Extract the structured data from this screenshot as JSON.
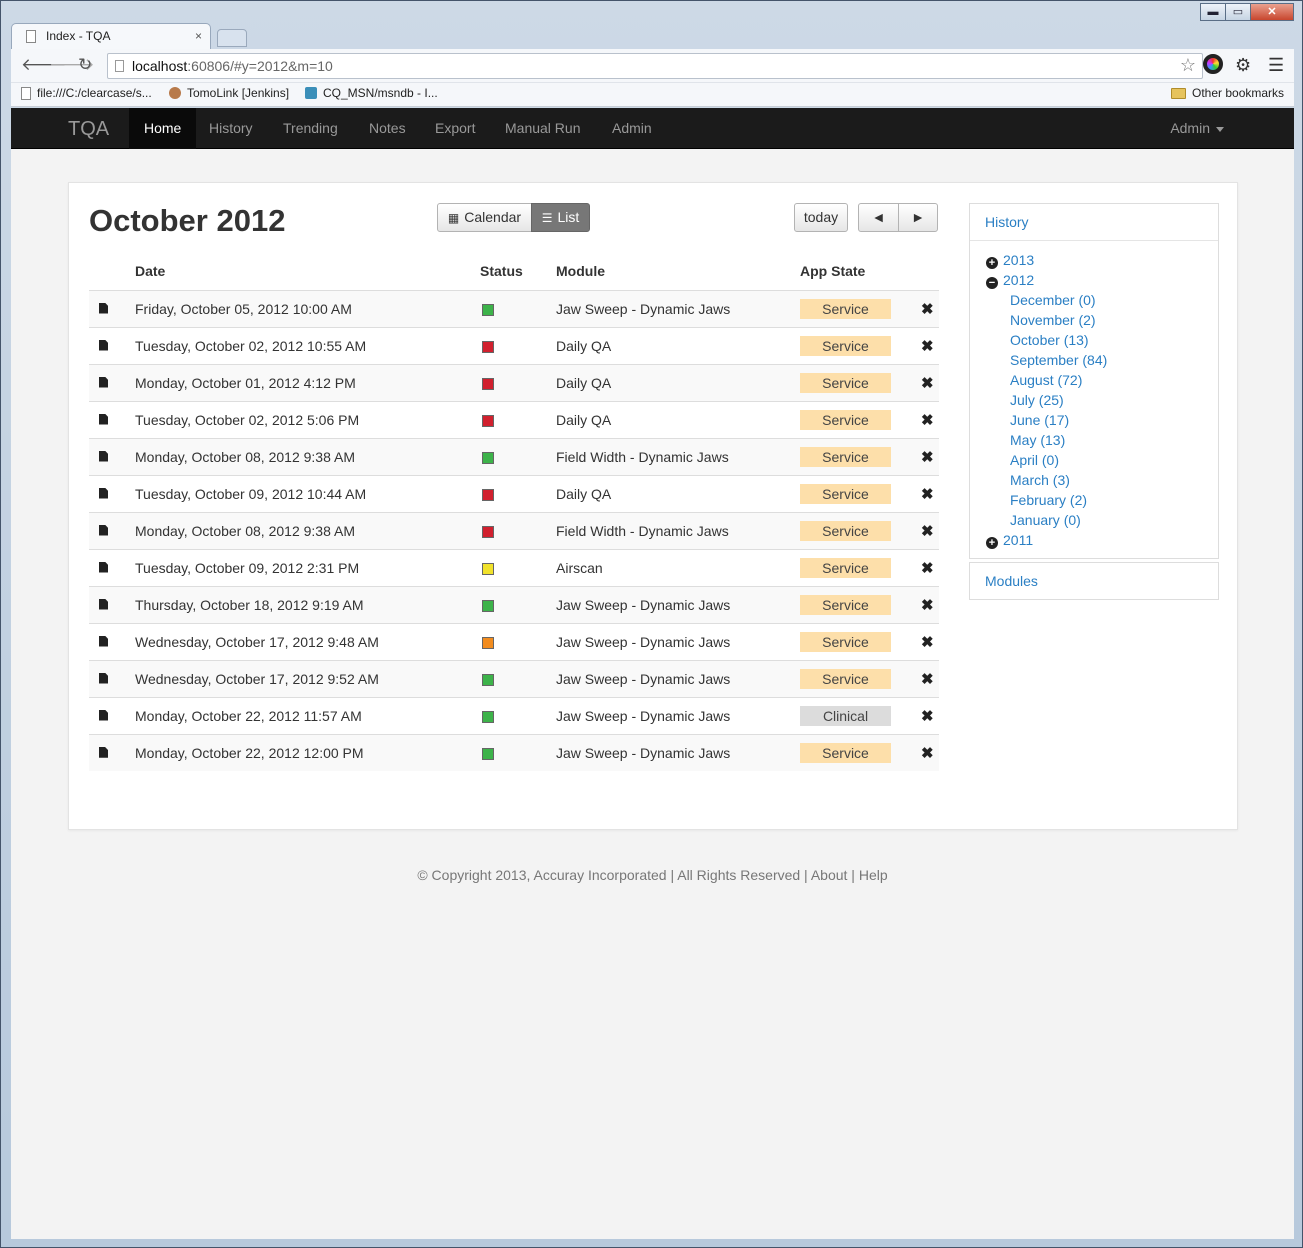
{
  "window": {
    "minimize": "▬",
    "restore": "▭",
    "close": "✕"
  },
  "tab": {
    "title": "Index - TQA",
    "close": "×"
  },
  "address": {
    "host": "localhost",
    "rest": ":60806/#y=2012&m=10"
  },
  "bookmarks": {
    "items": [
      "file:///C:/clearcase/s...",
      "TomoLink [Jenkins]",
      "CQ_MSN/msndb - I..."
    ],
    "other": "Other bookmarks"
  },
  "nav": {
    "brand": "TQA",
    "items": [
      "Home",
      "History",
      "Trending",
      "Notes",
      "Export",
      "Manual Run",
      "Admin"
    ],
    "user": "Admin"
  },
  "calendar": {
    "title": "October 2012",
    "view_calendar": "Calendar",
    "view_list": "List",
    "today": "today",
    "prev": "◄",
    "next": "►"
  },
  "table": {
    "headers": [
      "Date",
      "Status",
      "Module",
      "App State"
    ],
    "rows": [
      {
        "date": "Friday, October 05, 2012 10:00 AM",
        "status": "#3db34a",
        "module": "Jaw Sweep - Dynamic Jaws",
        "state": "Service"
      },
      {
        "date": "Tuesday, October 02, 2012 10:55 AM",
        "status": "#d1202e",
        "module": "Daily QA",
        "state": "Service"
      },
      {
        "date": "Monday, October 01, 2012 4:12 PM",
        "status": "#d1202e",
        "module": "Daily QA",
        "state": "Service"
      },
      {
        "date": "Tuesday, October 02, 2012 5:06 PM",
        "status": "#d1202e",
        "module": "Daily QA",
        "state": "Service"
      },
      {
        "date": "Monday, October 08, 2012 9:38 AM",
        "status": "#3db34a",
        "module": "Field Width - Dynamic Jaws",
        "state": "Service"
      },
      {
        "date": "Tuesday, October 09, 2012 10:44 AM",
        "status": "#d1202e",
        "module": "Daily QA",
        "state": "Service"
      },
      {
        "date": "Monday, October 08, 2012 9:38 AM",
        "status": "#d1202e",
        "module": "Field Width - Dynamic Jaws",
        "state": "Service"
      },
      {
        "date": "Tuesday, October 09, 2012 2:31 PM",
        "status": "#f1e22b",
        "module": "Airscan",
        "state": "Service"
      },
      {
        "date": "Thursday, October 18, 2012 9:19 AM",
        "status": "#3db34a",
        "module": "Jaw Sweep - Dynamic Jaws",
        "state": "Service"
      },
      {
        "date": "Wednesday, October 17, 2012 9:48 AM",
        "status": "#f28c1e",
        "module": "Jaw Sweep - Dynamic Jaws",
        "state": "Service"
      },
      {
        "date": "Wednesday, October 17, 2012 9:52 AM",
        "status": "#3db34a",
        "module": "Jaw Sweep - Dynamic Jaws",
        "state": "Service"
      },
      {
        "date": "Monday, October 22, 2012 11:57 AM",
        "status": "#3db34a",
        "module": "Jaw Sweep - Dynamic Jaws",
        "state": "Clinical"
      },
      {
        "date": "Monday, October 22, 2012 12:00 PM",
        "status": "#3db34a",
        "module": "Jaw Sweep - Dynamic Jaws",
        "state": "Service"
      }
    ]
  },
  "sidebar": {
    "history_title": "History",
    "tree": [
      {
        "label": "2013",
        "type": "year",
        "toggle": "+"
      },
      {
        "label": "2012",
        "type": "year",
        "toggle": "−"
      },
      {
        "label": "December (0)",
        "type": "month"
      },
      {
        "label": "November (2)",
        "type": "month"
      },
      {
        "label": "October (13)",
        "type": "month"
      },
      {
        "label": "September (84)",
        "type": "month"
      },
      {
        "label": "August (72)",
        "type": "month"
      },
      {
        "label": "July (25)",
        "type": "month"
      },
      {
        "label": "June (17)",
        "type": "month"
      },
      {
        "label": "May (13)",
        "type": "month"
      },
      {
        "label": "April (0)",
        "type": "month"
      },
      {
        "label": "March (3)",
        "type": "month"
      },
      {
        "label": "February (2)",
        "type": "month"
      },
      {
        "label": "January (0)",
        "type": "month"
      },
      {
        "label": "2011",
        "type": "year",
        "toggle": "+"
      }
    ],
    "modules_title": "Modules"
  },
  "footer": {
    "copyright": "© Copyright 2013, Accuray Incorporated",
    "sep1": " | ",
    "rights": "All Rights Reserved",
    "sep2": " | ",
    "about": "About",
    "sep3": " | ",
    "help": "Help"
  }
}
